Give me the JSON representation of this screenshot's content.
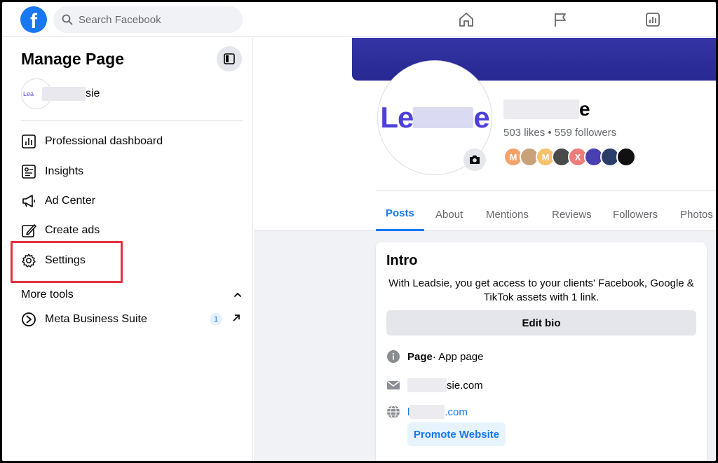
{
  "topbar": {
    "logo": "f",
    "search_placeholder": "Search Facebook",
    "icons": [
      "home-icon",
      "flag-icon",
      "insights-chart-icon"
    ]
  },
  "sidebar": {
    "title": "Manage Page",
    "page_avatar_text": "Lea",
    "page_name_suffix": "sie",
    "items": [
      {
        "label": "Professional dashboard",
        "icon": "dashboard-icon"
      },
      {
        "label": "Insights",
        "icon": "insights-icon"
      },
      {
        "label": "Ad Center",
        "icon": "megaphone-icon"
      },
      {
        "label": "Create ads",
        "icon": "pencil-icon"
      },
      {
        "label": "Settings",
        "icon": "gear-icon"
      }
    ],
    "more_tools": {
      "label": "More tools",
      "items": [
        {
          "label": "Meta Business Suite",
          "badge": "1",
          "icon": "meta-business-suite-icon"
        }
      ]
    }
  },
  "profile": {
    "logo_prefix": "Le",
    "logo_suffix": "e",
    "name_suffix": "e",
    "stats": "503 likes • 559 followers",
    "faces": [
      {
        "text": "M",
        "color": "#f5a26a"
      },
      {
        "text": "",
        "color": "#c9a27a"
      },
      {
        "text": "M",
        "color": "#f5c26a"
      },
      {
        "text": "",
        "color": "#4a4a4a"
      },
      {
        "text": "X",
        "color": "#f07b7b"
      },
      {
        "text": "",
        "color": "#4a3fb0"
      },
      {
        "text": "",
        "color": "#2b3e6b"
      },
      {
        "text": "",
        "color": "#111111"
      }
    ],
    "tabs": [
      "Posts",
      "About",
      "Mentions",
      "Reviews",
      "Followers",
      "Photos"
    ]
  },
  "intro": {
    "title": "Intro",
    "text": "With Leadsie, you get access to your clients' Facebook, Google & TikTok assets with 1 link.",
    "edit_bio_label": "Edit bio",
    "page_label": "Page",
    "page_category": " · App page",
    "email_suffix": "sie.com",
    "website_prefix": "l",
    "website_suffix": ".com",
    "promote_label": "Promote Website"
  },
  "colors": {
    "brand_blue": "#1877f2",
    "cover": "#2f2e9e",
    "highlight_red": "#e5323e",
    "logo_purple": "#4d3fd9"
  }
}
